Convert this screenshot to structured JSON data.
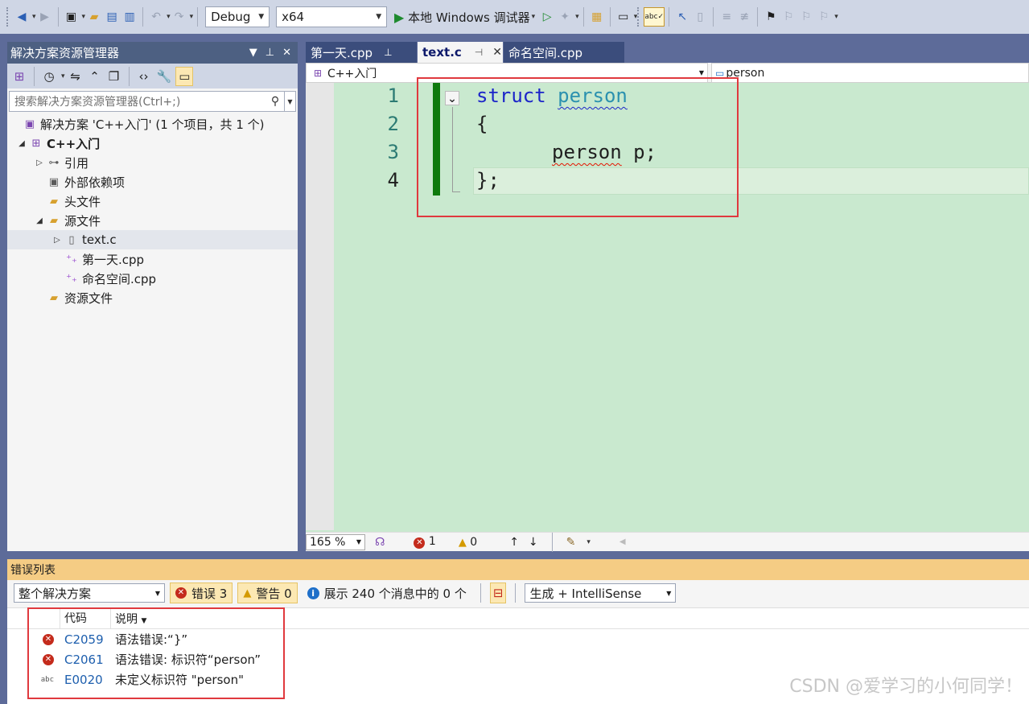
{
  "toolbar": {
    "configuration": "Debug",
    "platform": "x64",
    "debugger_label": "本地 Windows 调试器"
  },
  "solution_explorer": {
    "title": "解决方案资源管理器",
    "search_placeholder": "搜索解决方案资源管理器(Ctrl+;)",
    "tree": {
      "solution": "解决方案 'C++入门' (1 个项目，共 1 个)",
      "project": "C++入门",
      "references": "引用",
      "external_deps": "外部依赖项",
      "headers": "头文件",
      "sources": "源文件",
      "file_text_c": "text.c",
      "file_day1": "第一天.cpp",
      "file_namespace": "命名空间.cpp",
      "resources": "资源文件"
    }
  },
  "editor": {
    "tabs": [
      {
        "label": "第一天.cpp"
      },
      {
        "label": "text.c"
      },
      {
        "label": "命名空间.cpp"
      }
    ],
    "nav_left": "C++入门",
    "nav_right": "person",
    "line_numbers": [
      "1",
      "2",
      "3",
      "4"
    ],
    "code": {
      "l1_kw": "struct",
      "l1_type": "person",
      "l2": "{",
      "l3_err": "person",
      "l3_rest": " p;",
      "l4": "};"
    },
    "status": {
      "zoom": "165 %",
      "errors": "1",
      "warnings": "0"
    }
  },
  "error_list": {
    "title": "错误列表",
    "scope": "整个解决方案",
    "errors_btn": "错误 3",
    "warnings_btn": "警告 0",
    "messages_btn": "展示 240 个消息中的 0 个",
    "source": "生成 + IntelliSense",
    "col_code": "代码",
    "col_desc": "说明",
    "rows": [
      {
        "code": "C2059",
        "desc": "语法错误:“}”"
      },
      {
        "code": "C2061",
        "desc": "语法错误: 标识符“person”"
      },
      {
        "code": "E0020",
        "desc": "未定义标识符 \"person\""
      }
    ]
  },
  "watermark": "CSDN @爱学习的小何同学！",
  "colors": {
    "accent_title": "#4d6082",
    "editor_bg": "#c9e9cf",
    "error_list_title": "#f5cc84",
    "highlight_box": "#e0393e"
  }
}
